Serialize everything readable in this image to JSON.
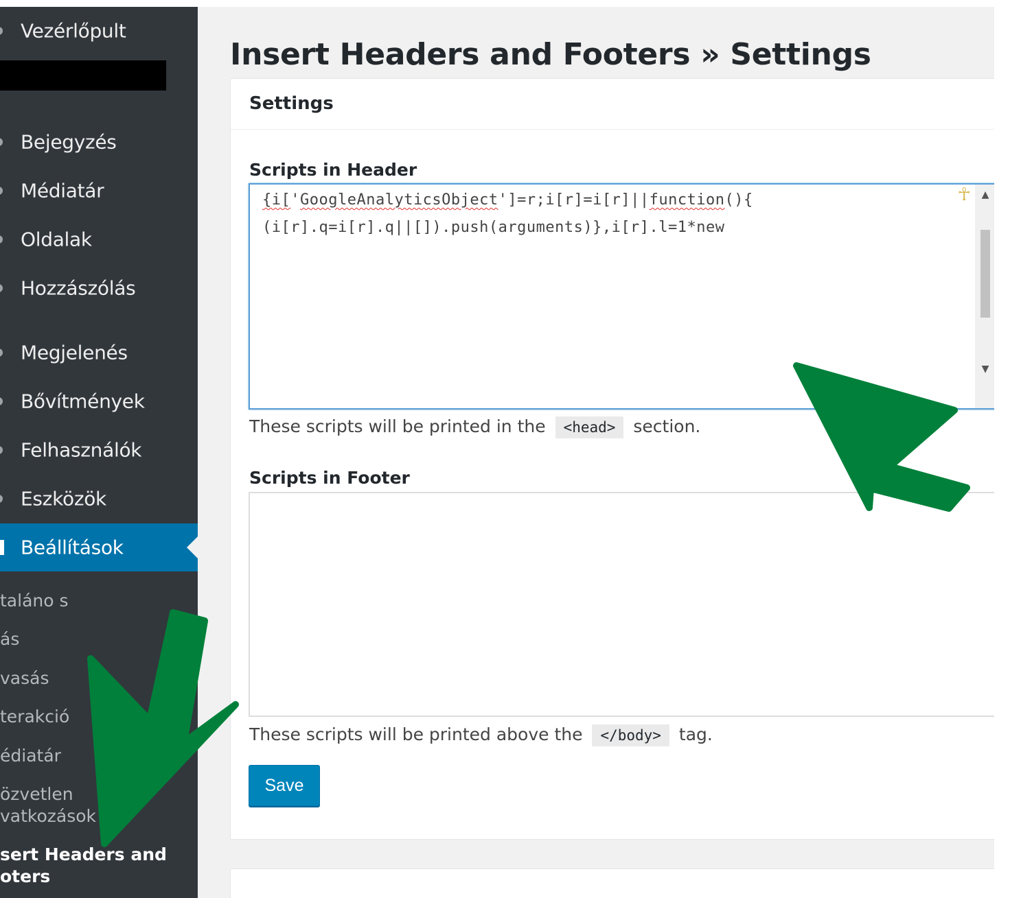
{
  "sidebar": {
    "top_item": "Vezérlőpult",
    "items": [
      {
        "label": "Bejegyzés"
      },
      {
        "label": "Médiatár"
      },
      {
        "label": "Oldalak"
      },
      {
        "label": "Hozzászólás"
      },
      {
        "label": "Megjelenés"
      },
      {
        "label": "Bővítmények"
      },
      {
        "label": "Felhasználók"
      },
      {
        "label": "Eszközök"
      },
      {
        "label": "Beállítások"
      }
    ],
    "submenu": [
      {
        "label": "taláno s"
      },
      {
        "label": "ás"
      },
      {
        "label": "vasás"
      },
      {
        "label": "terakció"
      },
      {
        "label": "édiatár"
      },
      {
        "label": "özvetlen"
      },
      {
        "label": "vatkozások"
      },
      {
        "label": "sert Headers and"
      },
      {
        "label": "oters"
      }
    ]
  },
  "page": {
    "title": "Insert Headers and Footers » Settings"
  },
  "panel": {
    "title": "Settings",
    "header_label": "Scripts in Header",
    "header_code": [
      "{i['GoogleAnalyticsObject']=r;i[r]=i[r]||function(){",
      "(i[r].q=i[r].q||[]).push(arguments)},i[r].l=1*new"
    ],
    "header_help_pre": "These scripts will be printed in the",
    "header_help_tag": "<head>",
    "header_help_post": "section.",
    "footer_label": "Scripts in Footer",
    "footer_help_pre": "These scripts will be printed above the",
    "footer_help_tag": "</body>",
    "footer_help_post": "tag.",
    "save_label": "Save"
  },
  "colors": {
    "sidebar_bg": "#32373c",
    "active_bg": "#0073aa",
    "button_bg": "#0085ba",
    "arrow": "#00803a"
  }
}
